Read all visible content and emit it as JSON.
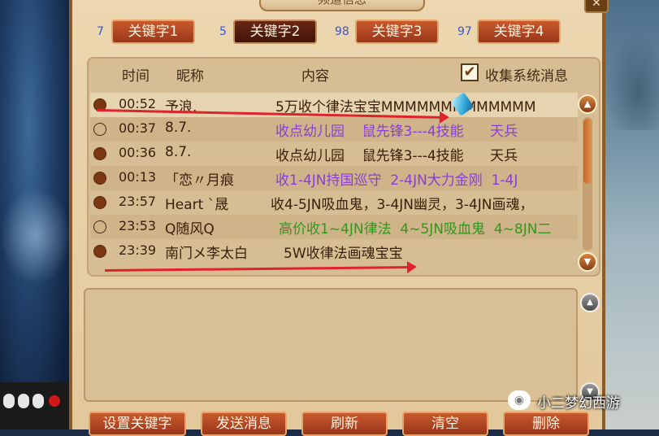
{
  "window": {
    "title": "频道信息",
    "close_label": "✕"
  },
  "keyword_tabs": [
    {
      "count": "7",
      "label": "关键字1",
      "active": false
    },
    {
      "count": "5",
      "label": "关键字2",
      "active": true
    },
    {
      "count": "98",
      "label": "关键字3",
      "active": false
    },
    {
      "count": "97",
      "label": "关键字4",
      "active": false
    }
  ],
  "header": {
    "time": "时间",
    "nickname": "昵称",
    "content": "内容",
    "collect_system": "收集系统消息",
    "collect_checked": true
  },
  "messages": [
    {
      "status": "filled",
      "time": "00:52",
      "nick": "予浪.",
      "content": "5万收个律法宝宝MMMMMMMMMMMMM",
      "color": "brown"
    },
    {
      "status": "hollow",
      "time": "00:37",
      "nick": "8.7.",
      "content": "收点幼儿园    鼠先锋3---4技能      天兵",
      "color": "purple"
    },
    {
      "status": "filled",
      "time": "00:36",
      "nick": "8.7.",
      "content": "收点幼儿园    鼠先锋3---4技能      天兵",
      "color": "brown"
    },
    {
      "status": "filled",
      "time": "00:13",
      "nick": "「恋〃月痕",
      "content": "收1-4JN持国巡守  2-4JN大力金刚  1-4J",
      "color": "purple"
    },
    {
      "status": "filled",
      "time": "23:57",
      "nick": "Heart `晟",
      "content": "收4-5JN吸血鬼，3-4JN幽灵，3-4JN画魂，",
      "color": "brown"
    },
    {
      "status": "hollow",
      "time": "23:53",
      "nick": "Q随风Q",
      "content": "高价收1~4JN律法  4~5JN吸血鬼  4~8JN二",
      "color": "green"
    },
    {
      "status": "filled",
      "time": "23:39",
      "nick": "南门メ李太白",
      "content": "5W收律法画魂宝宝",
      "color": "brown"
    }
  ],
  "scroll": {
    "up_icon": "▲",
    "down_icon": "▼"
  },
  "buttons": {
    "set_keyword": "设置关键字",
    "send": "发送消息",
    "refresh": "刷新",
    "clear": "清空",
    "delete": "删除"
  },
  "watermark": {
    "text": "小二梦幻西游"
  },
  "colors": {
    "accent": "#a5401f",
    "arrow": "#e0222a",
    "purple": "#8b3ed6",
    "green": "#2e9a1c"
  }
}
